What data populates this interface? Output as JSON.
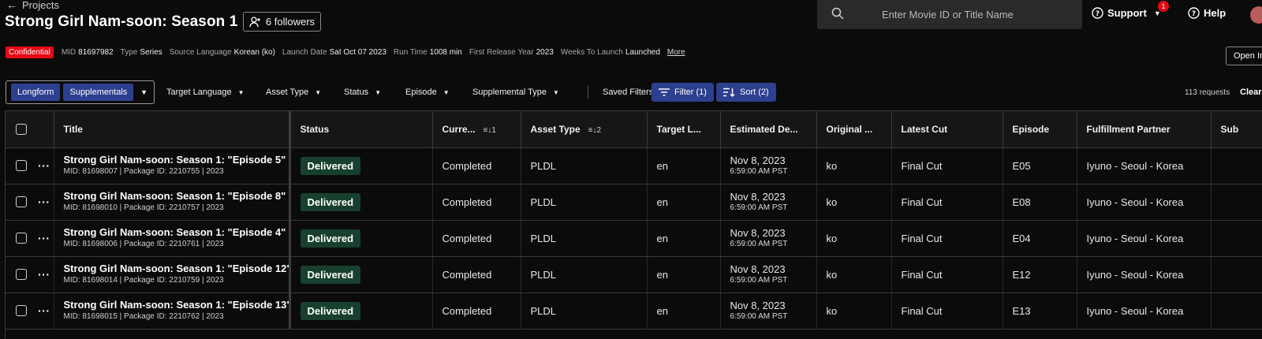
{
  "header": {
    "back_label": "Projects",
    "title": "Strong Girl Nam-soon: Season 1",
    "followers_label": "6 followers",
    "search_placeholder": "Enter Movie ID or Title Name",
    "support_label": "Support",
    "notification_count": "1",
    "help_label": "Help",
    "open_label": "Open In"
  },
  "meta": {
    "badge": "Confidential",
    "items": [
      {
        "label": "MID",
        "value": "81697982"
      },
      {
        "label": "Type",
        "value": "Series"
      },
      {
        "label": "Source Language",
        "value": "Korean (ko)"
      },
      {
        "label": "Launch Date",
        "value": "Sat Oct 07 2023"
      },
      {
        "label": "Run Time",
        "value": "1008 min"
      },
      {
        "label": "First Release Year",
        "value": "2023"
      },
      {
        "label": "Weeks To Launch",
        "value": "Launched"
      }
    ],
    "more_label": "More"
  },
  "filters": {
    "segments": [
      "Longform",
      "Supplementals"
    ],
    "dropdowns": [
      "Target Language",
      "Asset Type",
      "Status",
      "Episode",
      "Supplemental Type"
    ],
    "saved_filters": "Saved Filters",
    "filter_btn": "Filter (1)",
    "sort_btn": "Sort (2)",
    "request_count": "113 requests",
    "clear_label": "Clear"
  },
  "table": {
    "columns": [
      "Title",
      "Status",
      "Curre...",
      "Asset Type",
      "Target L...",
      "Estimated De...",
      "Original ...",
      "Latest Cut",
      "Episode",
      "Fulfillment Partner",
      "Sub"
    ],
    "sort_indicators": {
      "current": "1",
      "asset_type": "2"
    },
    "rows": [
      {
        "title": "Strong Girl Nam-soon: Season 1: \"Episode 5\"",
        "sub": "MID: 81698007 | Package ID: 2210755 | 2023",
        "status": "Delivered",
        "current": "Completed",
        "asset_type": "PLDL",
        "target_lang": "en",
        "date": "Nov 8, 2023",
        "time": "6:59:00 AM PST",
        "original": "ko",
        "latest_cut": "Final Cut",
        "episode": "E05",
        "partner": "Iyuno - Seoul - Korea"
      },
      {
        "title": "Strong Girl Nam-soon: Season 1: \"Episode 8\"",
        "sub": "MID: 81698010 | Package ID: 2210757 | 2023",
        "status": "Delivered",
        "current": "Completed",
        "asset_type": "PLDL",
        "target_lang": "en",
        "date": "Nov 8, 2023",
        "time": "6:59:00 AM PST",
        "original": "ko",
        "latest_cut": "Final Cut",
        "episode": "E08",
        "partner": "Iyuno - Seoul - Korea"
      },
      {
        "title": "Strong Girl Nam-soon: Season 1: \"Episode 4\"",
        "sub": "MID: 81698006 | Package ID: 2210761 | 2023",
        "status": "Delivered",
        "current": "Completed",
        "asset_type": "PLDL",
        "target_lang": "en",
        "date": "Nov 8, 2023",
        "time": "6:59:00 AM PST",
        "original": "ko",
        "latest_cut": "Final Cut",
        "episode": "E04",
        "partner": "Iyuno - Seoul - Korea"
      },
      {
        "title": "Strong Girl Nam-soon: Season 1: \"Episode 12\"",
        "sub": "MID: 81698014 | Package ID: 2210759 | 2023",
        "status": "Delivered",
        "current": "Completed",
        "asset_type": "PLDL",
        "target_lang": "en",
        "date": "Nov 8, 2023",
        "time": "6:59:00 AM PST",
        "original": "ko",
        "latest_cut": "Final Cut",
        "episode": "E12",
        "partner": "Iyuno - Seoul - Korea"
      },
      {
        "title": "Strong Girl Nam-soon: Season 1: \"Episode 13\"",
        "sub": "MID: 81698015 | Package ID: 2210762 | 2023",
        "status": "Delivered",
        "current": "Completed",
        "asset_type": "PLDL",
        "target_lang": "en",
        "date": "Nov 8, 2023",
        "time": "6:59:00 AM PST",
        "original": "ko",
        "latest_cut": "Final Cut",
        "episode": "E13",
        "partner": "Iyuno - Seoul - Korea"
      }
    ]
  },
  "colors": {
    "background": "#0b0b0b",
    "accent": "#2d3f8f",
    "confidential": "#e50914",
    "delivered": "#18402e"
  }
}
